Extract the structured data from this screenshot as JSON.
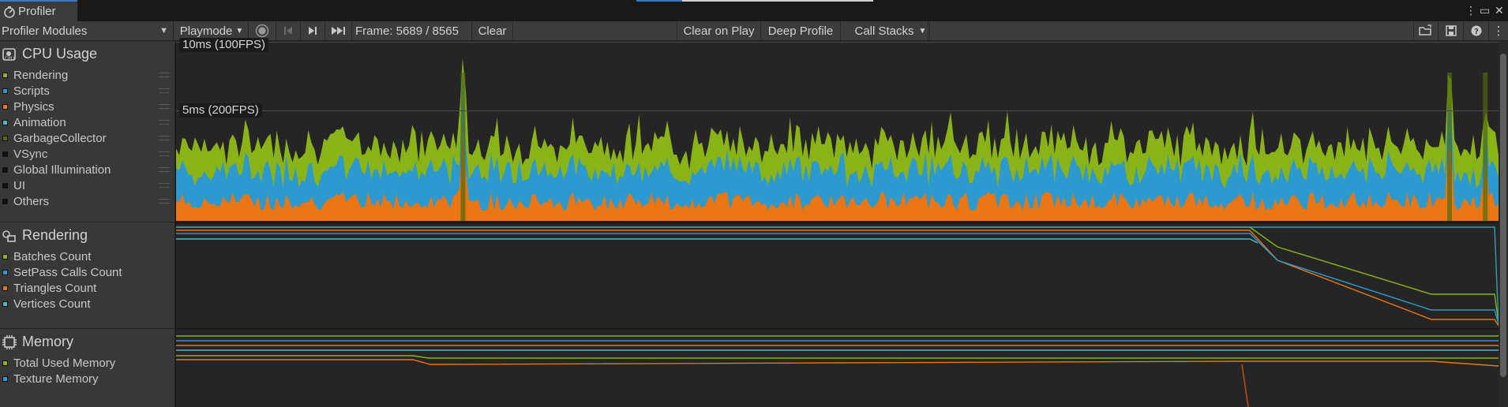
{
  "window": {
    "tab_title": "Profiler",
    "controls": {
      "more": "⋮",
      "maximize": "▭",
      "close": "✕"
    }
  },
  "toolbar": {
    "modules_dropdown": "Profiler Modules",
    "playmode": "Playmode",
    "frame": "Frame: 5689 / 8565",
    "clear": "Clear",
    "clear_on_play": "Clear on Play",
    "deep_profile": "Deep Profile",
    "call_stacks": "Call Stacks"
  },
  "colors": {
    "green": "#8ab317",
    "blue": "#2d9acf",
    "orange": "#e97612",
    "cyan": "#52b4cc",
    "olive": "#506a10",
    "black": "#111111",
    "teal": "#2f9fb0"
  },
  "modules": [
    {
      "name": "CPU Usage",
      "icon": "cpu-icon",
      "legend": [
        {
          "label": "Rendering",
          "color": "#8ab317"
        },
        {
          "label": "Scripts",
          "color": "#2d9acf"
        },
        {
          "label": "Physics",
          "color": "#e97612"
        },
        {
          "label": "Animation",
          "color": "#52b4cc"
        },
        {
          "label": "GarbageCollector",
          "color": "#506a10"
        },
        {
          "label": "VSync",
          "color": "#111111"
        },
        {
          "label": "Global Illumination",
          "color": "#111111"
        },
        {
          "label": "UI",
          "color": "#111111"
        },
        {
          "label": "Others",
          "color": "#111111"
        }
      ]
    },
    {
      "name": "Rendering",
      "icon": "rendering-icon",
      "legend": [
        {
          "label": "Batches Count",
          "color": "#8ab317"
        },
        {
          "label": "SetPass Calls Count",
          "color": "#2d9acf"
        },
        {
          "label": "Triangles Count",
          "color": "#e97612"
        },
        {
          "label": "Vertices Count",
          "color": "#52b4cc"
        }
      ]
    },
    {
      "name": "Memory",
      "icon": "memory-chip-icon",
      "legend": [
        {
          "label": "Total Used Memory",
          "color": "#8ab317"
        },
        {
          "label": "Texture Memory",
          "color": "#2d9acf"
        }
      ]
    }
  ],
  "cpu_chart": {
    "guide_10ms": "10ms (100FPS)",
    "guide_5ms": "5ms (200FPS)"
  },
  "chart_data": {
    "type": "area",
    "ylabel": "ms",
    "spikes": [
      {
        "frame_fraction": 0.217,
        "value_ms": 10.0
      },
      {
        "frame_fraction": 0.963,
        "value_ms": 9.8
      },
      {
        "frame_fraction": 0.99,
        "value_ms": 6.6
      }
    ]
  }
}
